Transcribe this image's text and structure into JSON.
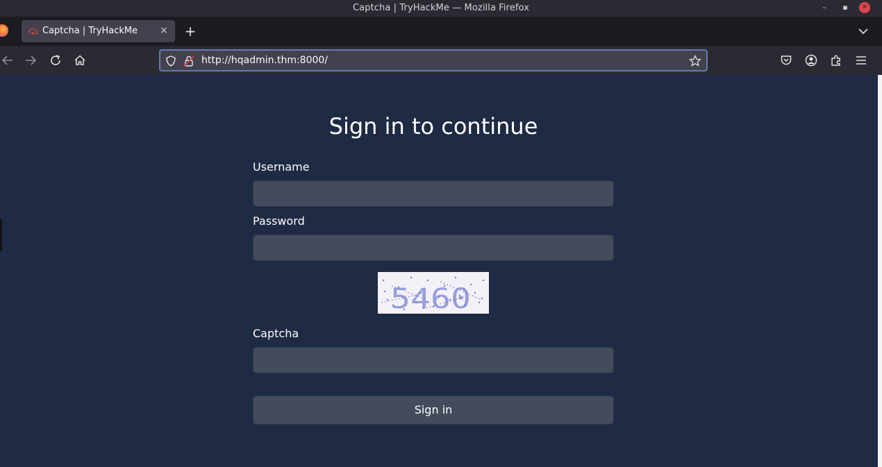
{
  "window": {
    "title": "Captcha | TryHackMe — Mozilla Firefox",
    "controls": {
      "minimize": "–",
      "maximize": "▪",
      "close": "✕"
    }
  },
  "tabs": [
    {
      "label": "Captcha | TryHackMe",
      "favicon": "tryhackme-icon",
      "active": true
    }
  ],
  "newtab_icon": "+",
  "navbar": {
    "url": "http://hqadmin.thm:8000/",
    "icons": [
      "back-icon",
      "forward-icon",
      "reload-icon",
      "home-icon",
      "shield-icon",
      "insecure-lock-icon",
      "bookmark-star-icon",
      "pocket-icon",
      "account-icon",
      "extensions-icon",
      "menu-icon"
    ]
  },
  "page": {
    "heading": "Sign in to continue",
    "username_label": "Username",
    "username_value": "",
    "password_label": "Password",
    "password_value": "",
    "captcha_text": "5460",
    "captcha_label": "Captcha",
    "captcha_value": "",
    "submit_label": "Sign in"
  },
  "colors": {
    "page_bg": "#1f2a44",
    "input_bg": "#434b5c",
    "chrome_bg": "#2b2a33",
    "tabstrip_bg": "#1c1b22",
    "urlbar_focus": "#5f7fb8",
    "captcha_ink": "#6f79c9"
  }
}
